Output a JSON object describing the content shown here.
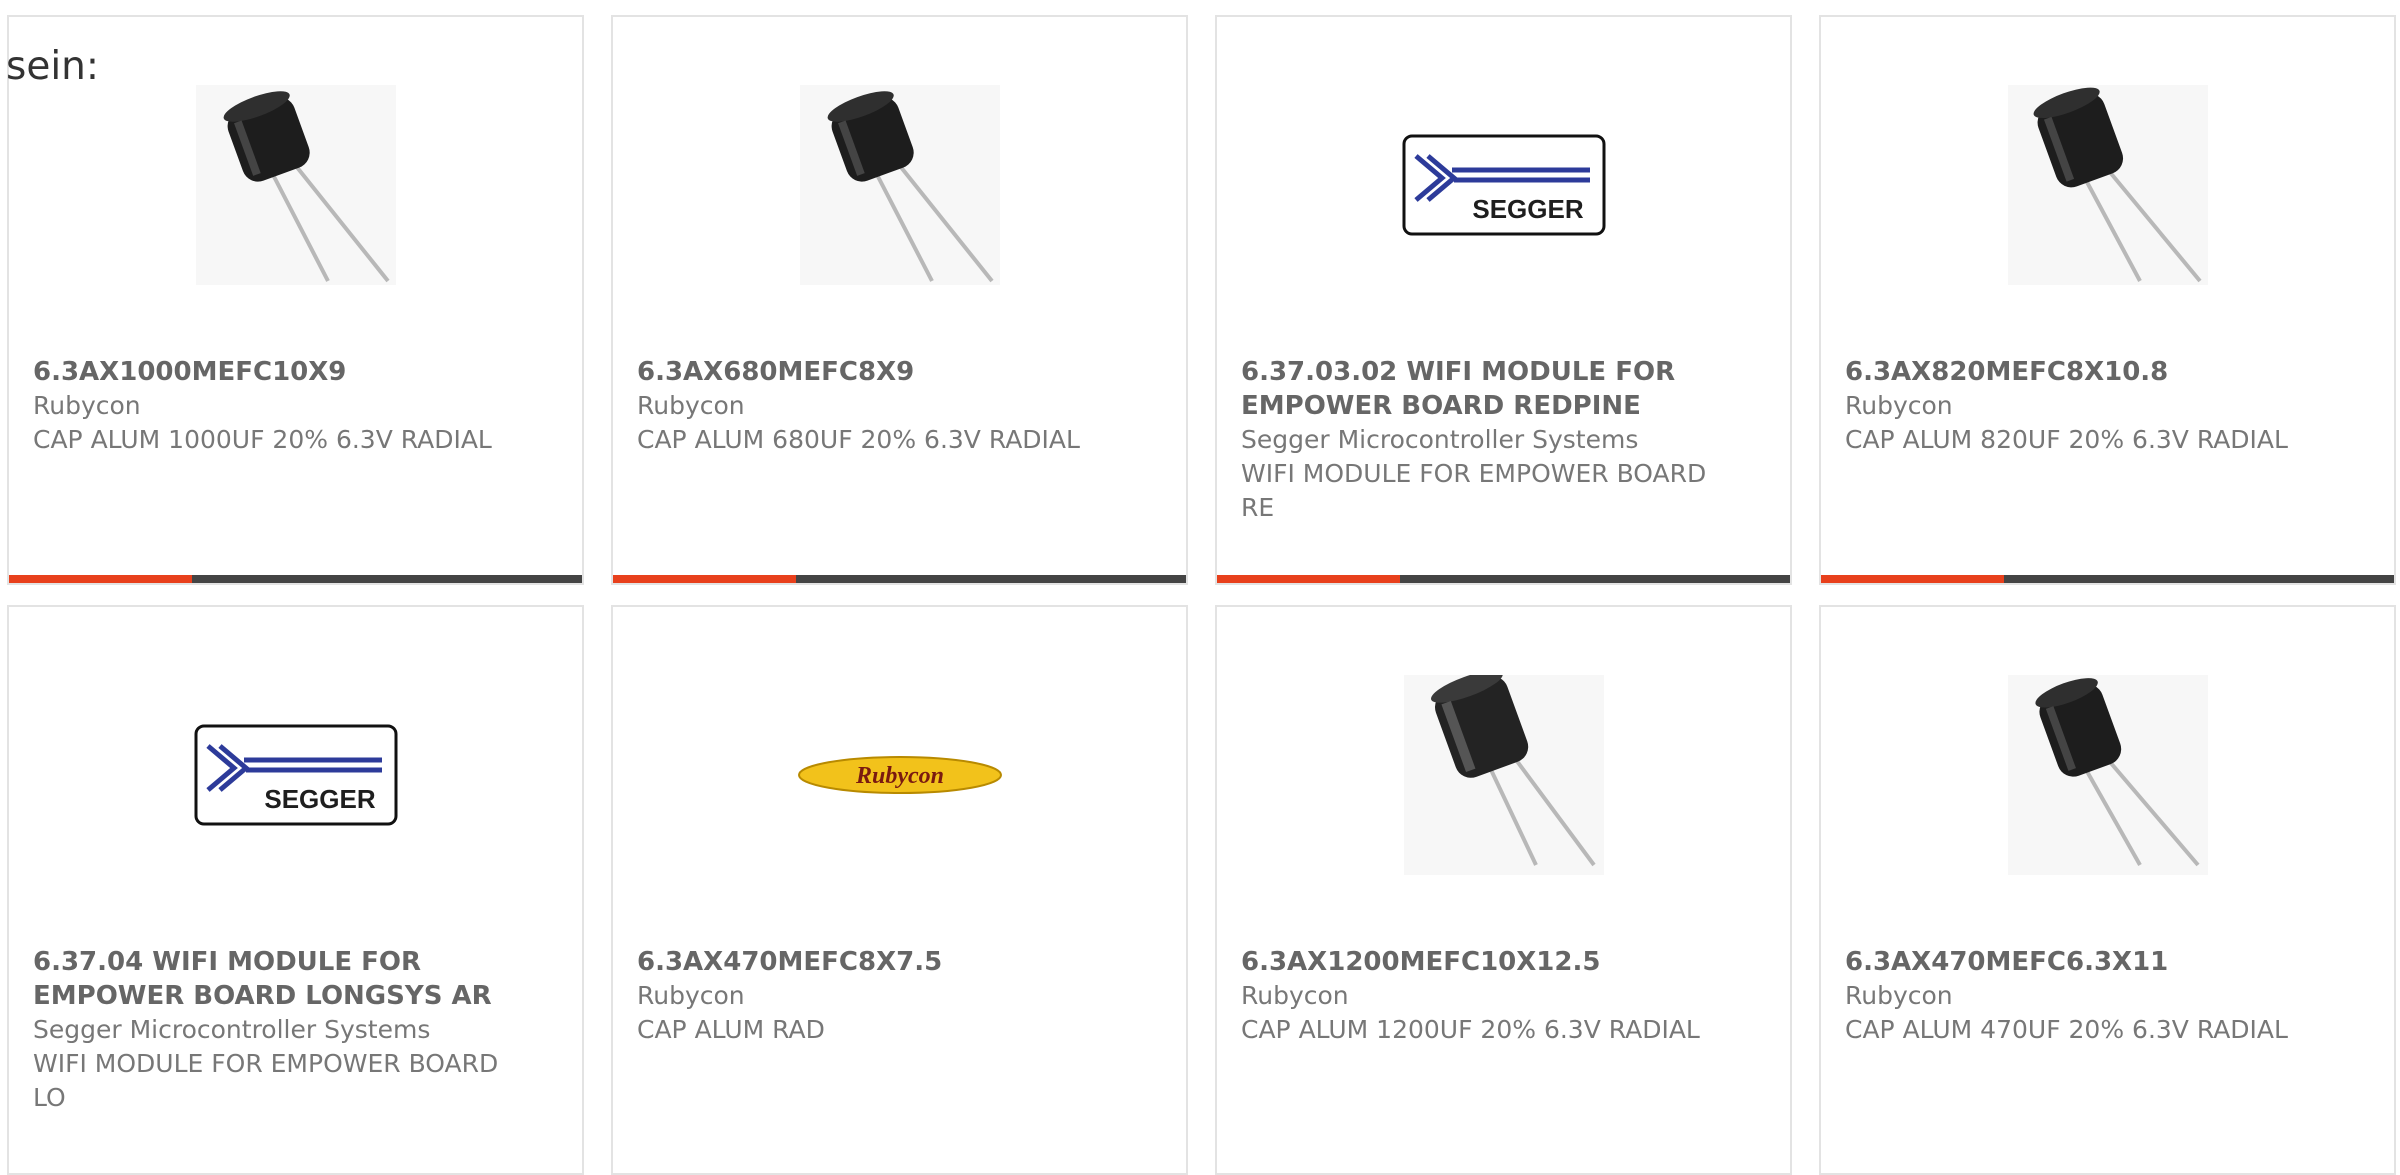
{
  "lead_text": "sein:",
  "cards": [
    {
      "part": "6.3AX1000MEFC10X9",
      "manufacturer": "Rubycon",
      "description": "CAP ALUM 1000UF 20% 6.3V RADIAL",
      "image": "capacitor-image"
    },
    {
      "part": "6.3AX680MEFC8X9",
      "manufacturer": "Rubycon",
      "description": "CAP ALUM 680UF 20% 6.3V RADIAL",
      "image": "capacitor-image"
    },
    {
      "part": "6.37.03.02 WIFI MODULE FOR EMPOWER BOARD REDPINE",
      "manufacturer": "Segger Microcontroller Systems",
      "description": "WIFI MODULE FOR EMPOWER BOARD RE",
      "image": "segger-logo",
      "logo_text": "SEGGER"
    },
    {
      "part": "6.3AX820MEFC8X10.8",
      "manufacturer": "Rubycon",
      "description": "CAP ALUM 820UF 20% 6.3V RADIAL",
      "image": "capacitor-image"
    },
    {
      "part": "6.37.04 WIFI MODULE FOR EMPOWER BOARD LONGSYS AR",
      "manufacturer": "Segger Microcontroller Systems",
      "description": "WIFI MODULE FOR EMPOWER BOARD LO",
      "image": "segger-logo",
      "logo_text": "SEGGER"
    },
    {
      "part": "6.3AX470MEFC8X7.5",
      "manufacturer": "Rubycon",
      "description": "CAP ALUM RAD",
      "image": "rubycon-logo",
      "logo_text": "Rubycon"
    },
    {
      "part": "6.3AX1200MEFC10X12.5",
      "manufacturer": "Rubycon",
      "description": "CAP ALUM 1200UF 20% 6.3V RADIAL",
      "image": "capacitor-image"
    },
    {
      "part": "6.3AX470MEFC6.3X11",
      "manufacturer": "Rubycon",
      "description": "CAP ALUM 470UF 20% 6.3V RADIAL",
      "image": "capacitor-image"
    }
  ],
  "colors": {
    "accent": "#e8401c",
    "bar": "#444444",
    "border": "#e3e3e3",
    "segger_blue": "#2d3b9a",
    "rubycon_yellow": "#f2c21b"
  }
}
